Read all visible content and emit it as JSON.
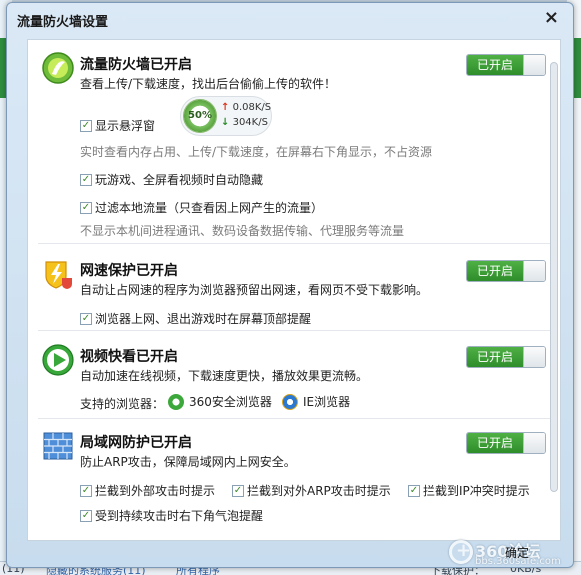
{
  "dialog": {
    "title": "流量防火墙设置",
    "close_label": "×",
    "confirm_label": "确定"
  },
  "toggle_label": "已开启",
  "firewall": {
    "title": "流量防火墙已开启",
    "desc": "查看上传/下载速度，找出后台偷偷上传的软件！",
    "float_window_label": "显示悬浮窗",
    "float_window_checked": true,
    "float_note": "实时查看内存占用、上传/下载速度，在屏幕右下角显示，不占资源",
    "hide_in_game_label": "玩游戏、全屏看视频时自动隐藏",
    "hide_in_game_checked": true,
    "filter_local_label": "过滤本地流量（只查看因上网产生的流量）",
    "filter_local_checked": true,
    "filter_note": "不显示本机间进程通讯、数码设备数据传输、代理服务等流量",
    "widget": {
      "percent": "50%",
      "upload": "0.08K/S",
      "download": "304K/S"
    }
  },
  "speed_protect": {
    "title": "网速保护已开启",
    "desc": "自动让占网速的程序为浏览器预留出网速，看网页不受下载影响。",
    "remind_label": "浏览器上网、退出游戏时在屏幕顶部提醒",
    "remind_checked": true
  },
  "video": {
    "title": "视频快看已开启",
    "desc": "自动加速在线视频，下载速度更快，播放效果更流畅。",
    "browsers_label": "支持的浏览器：",
    "browsers": [
      "360安全浏览器",
      "IE浏览器"
    ]
  },
  "lan": {
    "title": "局域网防护已开启",
    "desc": "防止ARP攻击，保障局域网内上网安全。",
    "options": [
      {
        "label": "拦截到外部攻击时提示",
        "checked": true
      },
      {
        "label": "拦截到对外ARP攻击时提示",
        "checked": true
      },
      {
        "label": "拦截到IP冲突时提示",
        "checked": true
      },
      {
        "label": "受到持续攻击时右下角气泡提醒",
        "checked": true
      }
    ]
  },
  "background": {
    "bottom_left": "(11)",
    "bottom_mid": "隐藏的系统服务(11)",
    "bottom_mid2": "所有程序",
    "bottom_right": "下载保护：",
    "bottom_right2": "0KB/s"
  },
  "watermark": {
    "text": "360论坛",
    "url": "bbs.360safe.com"
  },
  "colors": {
    "toggle_green": "#3a9c33",
    "title_bar": "#dbe9f6"
  }
}
